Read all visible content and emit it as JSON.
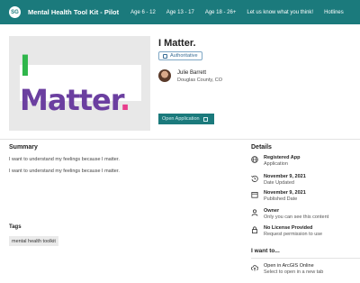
{
  "header": {
    "logo_text": "SG",
    "site_title": "Mental Health Tool Kit - Pilot",
    "nav": [
      "Age 6 - 12",
      "Age 13 - 17",
      "Age 18 - 26+",
      "Let us know what you think!",
      "Hotlines"
    ]
  },
  "item": {
    "thumbnail_text": {
      "i": "I",
      "rest": " Matter",
      "dot": "."
    },
    "title": "I Matter.",
    "badge": "Authoritative",
    "owner_name": "Julie Barrett",
    "owner_location": "Douglas County, CO",
    "open_button": "Open Application"
  },
  "summary": {
    "heading": "Summary",
    "lines": [
      "I want to understand my feelings because I matter.",
      "I want to understand my feelings because I matter."
    ]
  },
  "tags": {
    "heading": "Tags",
    "items": [
      "mental health toolkit"
    ]
  },
  "details": {
    "heading": "Details",
    "rows": [
      {
        "icon": "globe-icon",
        "title": "Registered App",
        "sub": "Application"
      },
      {
        "icon": "history-icon",
        "title": "November 9, 2021",
        "sub": "Date Updated"
      },
      {
        "icon": "calendar-icon",
        "title": "November 9, 2021",
        "sub": "Published Date"
      },
      {
        "icon": "user-icon",
        "title": "Owner",
        "sub": "Only you can see this content"
      },
      {
        "icon": "lock-icon",
        "title": "No License Provided",
        "sub": "Request permission to use"
      }
    ]
  },
  "iwant": {
    "heading": "I want to...",
    "action_title": "Open in ArcGIS Online",
    "action_sub": "Select to open in a new tab"
  },
  "colors": {
    "brand": "#1b7a7c",
    "purple": "#6b3fa0",
    "green": "#2fb64b",
    "pink": "#e83e8c"
  }
}
